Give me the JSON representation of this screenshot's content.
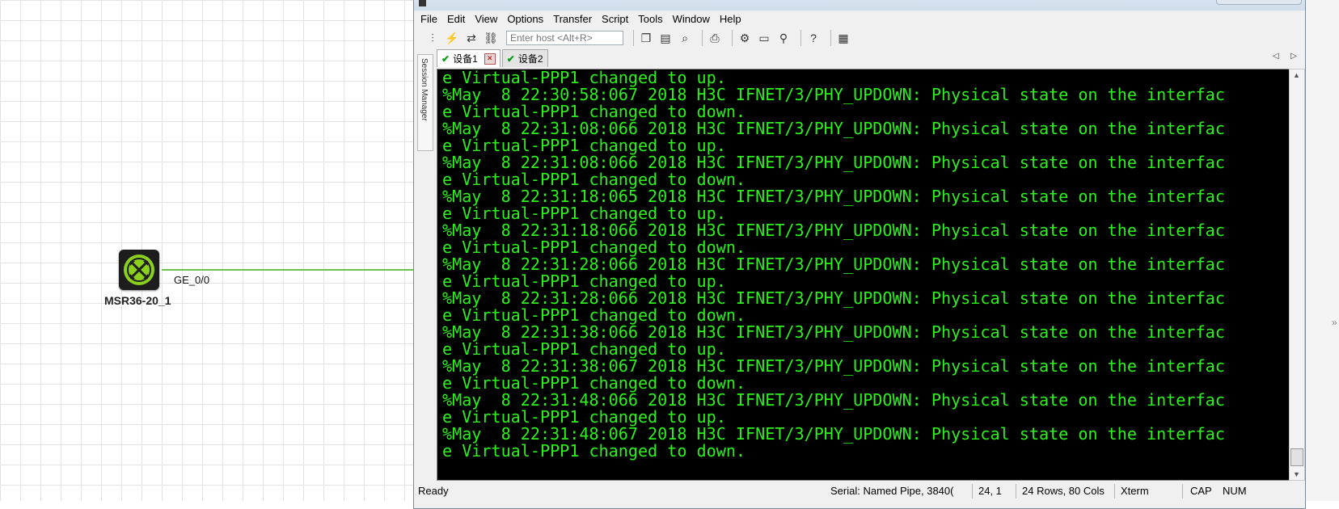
{
  "topology": {
    "device_label": "MSR36-20_1",
    "port_label": "GE_0/0",
    "link_color": "#6bc04f"
  },
  "window": {
    "menu": [
      "File",
      "Edit",
      "View",
      "Options",
      "Transfer",
      "Script",
      "Tools",
      "Window",
      "Help"
    ],
    "host_placeholder": "Enter host <Alt+R>",
    "toolbar_icons": [
      "connect-icon",
      "quick-connect-icon",
      "reconnect-icon",
      "link-icon",
      "copy-icon",
      "paste-icon",
      "find-icon",
      "print-icon",
      "settings-icon",
      "keymap-icon",
      "key-icon",
      "help-icon",
      "calculator-icon"
    ],
    "session_manager_label": "Session Manager",
    "tabs": [
      {
        "label": "设备1",
        "active": true
      },
      {
        "label": "设备2",
        "active": false
      }
    ],
    "terminal_color": "#2bf01a",
    "terminal_lines": [
      "e Virtual-PPP1 changed to up.",
      "%May  8 22:30:58:067 2018 H3C IFNET/3/PHY_UPDOWN: Physical state on the interfac",
      "e Virtual-PPP1 changed to down.",
      "%May  8 22:31:08:066 2018 H3C IFNET/3/PHY_UPDOWN: Physical state on the interfac",
      "e Virtual-PPP1 changed to up.",
      "%May  8 22:31:08:066 2018 H3C IFNET/3/PHY_UPDOWN: Physical state on the interfac",
      "e Virtual-PPP1 changed to down.",
      "%May  8 22:31:18:065 2018 H3C IFNET/3/PHY_UPDOWN: Physical state on the interfac",
      "e Virtual-PPP1 changed to up.",
      "%May  8 22:31:18:066 2018 H3C IFNET/3/PHY_UPDOWN: Physical state on the interfac",
      "e Virtual-PPP1 changed to down.",
      "%May  8 22:31:28:066 2018 H3C IFNET/3/PHY_UPDOWN: Physical state on the interfac",
      "e Virtual-PPP1 changed to up.",
      "%May  8 22:31:28:066 2018 H3C IFNET/3/PHY_UPDOWN: Physical state on the interfac",
      "e Virtual-PPP1 changed to down.",
      "%May  8 22:31:38:066 2018 H3C IFNET/3/PHY_UPDOWN: Physical state on the interfac",
      "e Virtual-PPP1 changed to up.",
      "%May  8 22:31:38:067 2018 H3C IFNET/3/PHY_UPDOWN: Physical state on the interfac",
      "e Virtual-PPP1 changed to down.",
      "%May  8 22:31:48:066 2018 H3C IFNET/3/PHY_UPDOWN: Physical state on the interfac",
      "e Virtual-PPP1 changed to up.",
      "%May  8 22:31:48:067 2018 H3C IFNET/3/PHY_UPDOWN: Physical state on the interfac",
      "e Virtual-PPP1 changed to down."
    ],
    "status": {
      "state": "Ready",
      "serial": "Serial: Named Pipe, 3840(",
      "cursor": "24,  1",
      "size": "24 Rows, 80 Cols",
      "term": "Xterm",
      "caps": "CAP",
      "num": "NUM"
    }
  }
}
